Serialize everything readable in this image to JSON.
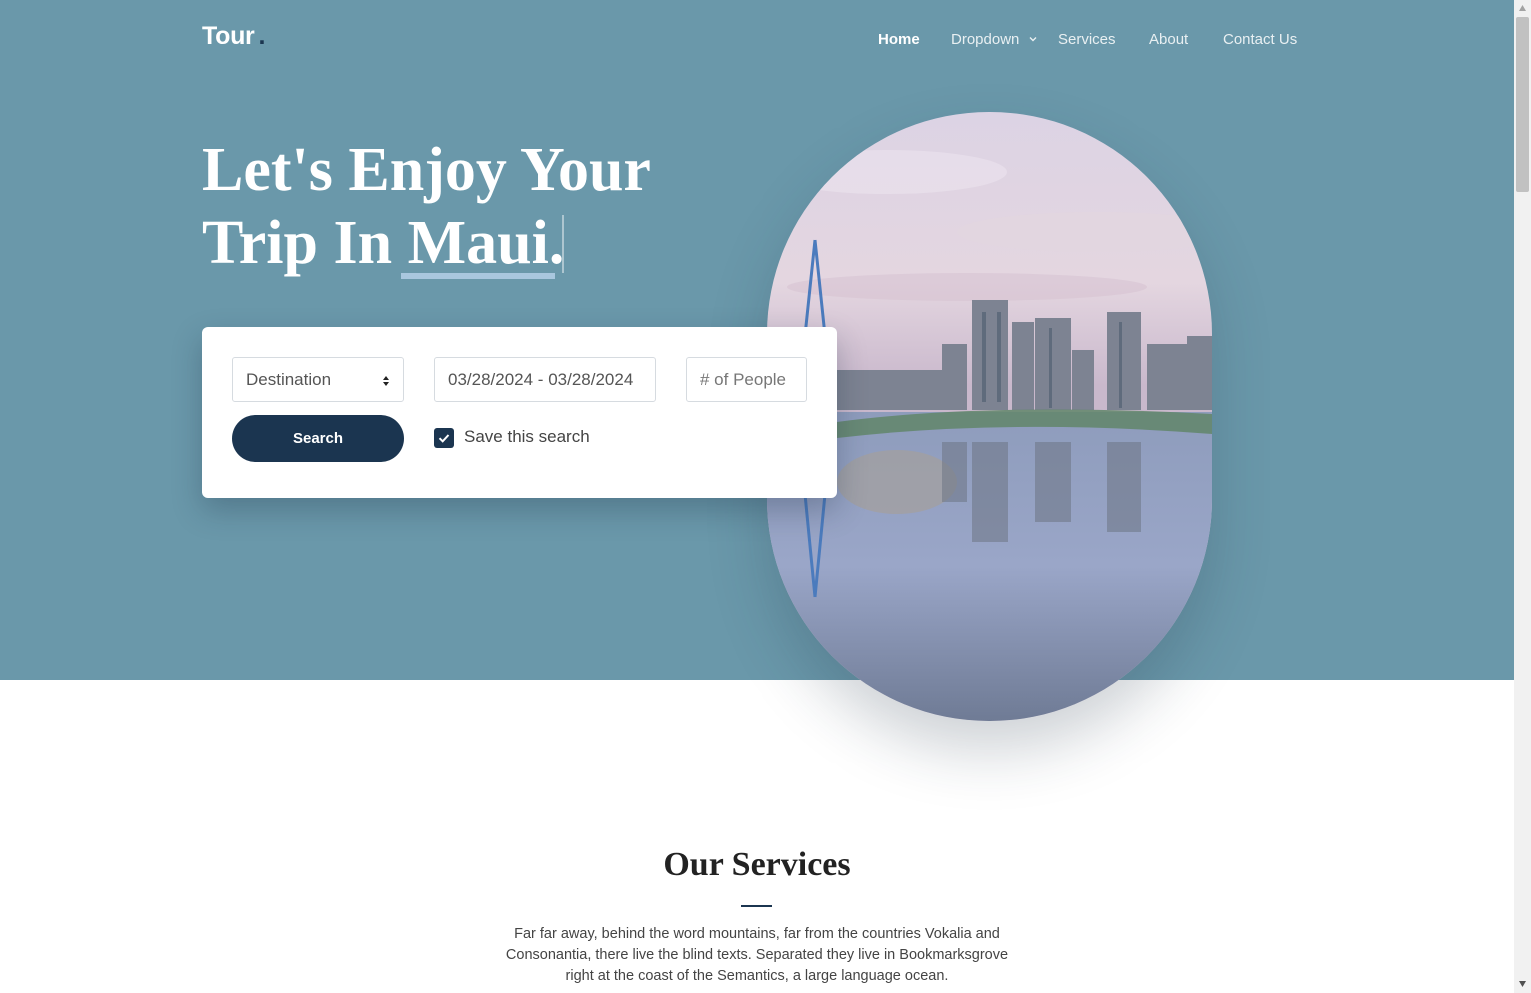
{
  "header": {
    "logo": "Tour",
    "logo_dot": ".",
    "nav": [
      "Home",
      "Dropdown",
      "Services",
      "About",
      "Contact Us"
    ],
    "active_nav": "Home"
  },
  "hero": {
    "title_line1": "Let's Enjoy Your",
    "title_line2_prefix": "Trip In ",
    "title_highlight": "Maui."
  },
  "search": {
    "destination_value": "Destination",
    "dates_value": "03/28/2024 - 03/28/2024",
    "people_placeholder": "# of People",
    "button_label": "Search",
    "save_checked": true,
    "save_label": "Save this search"
  },
  "services": {
    "title": "Our Services",
    "text": "Far far away, behind the word mountains, far from the countries Vokalia and Consonantia, there live the blind texts. Separated they live in Bookmarksgrove right at the coast of the Semantics, a large language ocean."
  },
  "colors": {
    "hero_bg": "#6a98aa",
    "accent": "#1b3550",
    "highlight_underline": "#a9c7de"
  },
  "icons": {
    "dropdown": "chevron-down-icon",
    "select": "select-arrows-icon",
    "checkbox": "check-icon",
    "photo": "city-skyline-image"
  }
}
